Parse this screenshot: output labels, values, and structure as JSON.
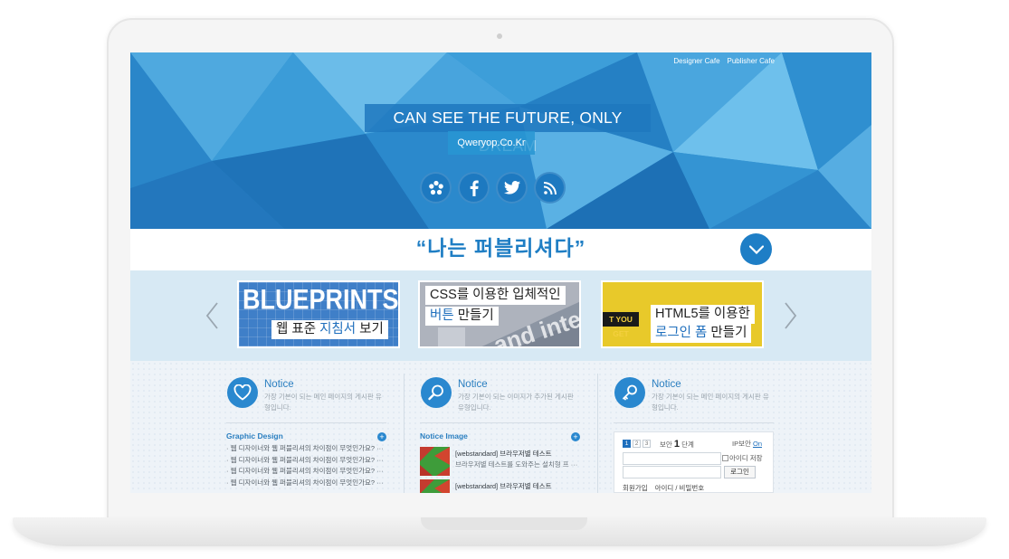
{
  "top_links": [
    "Designer Cafe",
    "Publisher Cafe"
  ],
  "hero": {
    "title": "CAN SEE THE FUTURE, ONLY DREAM",
    "subtitle": "Qweryop.Co.Kr",
    "social_icons": [
      "flower-icon",
      "facebook-icon",
      "twitter-icon",
      "rss-icon"
    ]
  },
  "slogan": "“나는 퍼블리셔다”",
  "banners": [
    {
      "headline": "BLUEPRINTS",
      "text_plain": "웹 표준 ",
      "text_highlight": "지침서",
      "text_tail": " 보기"
    },
    {
      "line1": "CSS를 이용한 입체적인",
      "line2_highlight": "버튼",
      "line2_tail": " 만들기",
      "bg_text": "and inte"
    },
    {
      "side_text": "T YOU GET",
      "line1": "HTML5를 이용한",
      "line2_highlight": "로그인 폼",
      "line2_tail": " 만들기"
    }
  ],
  "columns": [
    {
      "title": "Notice",
      "desc": "가장 기본이 되는 메인 페이지의 게시판 유형입니다.",
      "list_title": "Graphic Design",
      "posts": [
        "· 웹 디자이너와 웹 퍼블리셔의 차이점이 무엇인가요? ···",
        "· 웹 디자이너와 웹 퍼블리셔의 차이점이 무엇인가요? ···",
        "· 웹 디자이너와 웹 퍼블리셔의 차이점이 무엇인가요? ···",
        "· 웹 디자이너와 웹 퍼블리셔의 차이점이 무엇인가요? ···"
      ]
    },
    {
      "title": "Notice",
      "desc": "가장 기본이 되는 이미지가 추가된 게시판 유형입니다.",
      "list_title": "Notice Image",
      "image_posts": [
        {
          "title": "[webstandard] 브라우저별 테스트",
          "desc": "브라우저별 테스트를 도와주는 설치형 프 ···"
        },
        {
          "title": "[webstandard] 브라우저별 테스트",
          "desc": ""
        }
      ]
    },
    {
      "title": "Notice",
      "desc": "가장 기본이 되는 메인 페이지의 게시판 유형입니다.",
      "login": {
        "steps": [
          "1",
          "2",
          "3"
        ],
        "security_prefix": "보안",
        "security_level": "1",
        "security_suffix": "단계",
        "ip_prefix": "IP보안",
        "ip_state": "On",
        "save_id": "아이디 저장",
        "login_button": "로그인",
        "join": "회원가입",
        "find": "아이디 / 비밀번호"
      }
    }
  ],
  "colors": {
    "accent": "#1e7ec6",
    "hero": "#2f8fd0",
    "banner_row": "#d7e9f4"
  }
}
